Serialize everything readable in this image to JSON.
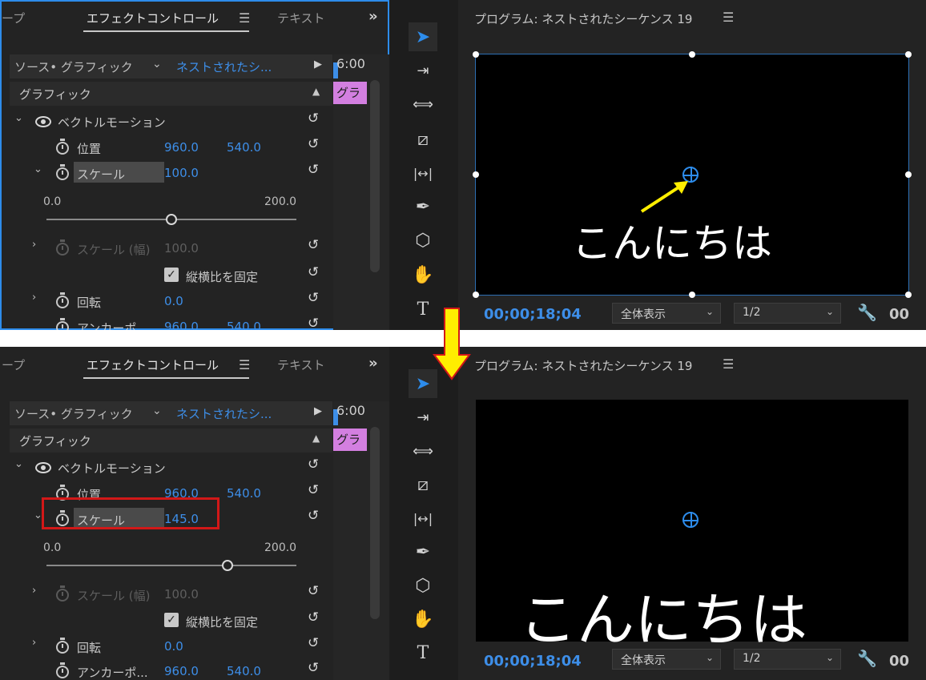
{
  "panels": [
    {
      "tabs": {
        "left_partial": "ープ",
        "active": "エフェクトコントロール",
        "text": "テキスト"
      },
      "source": {
        "label": "ソース• グラフィック",
        "clip": "ネストされたシ..."
      },
      "timeline_time": "6:00",
      "clip_label": "グラ",
      "section_title": "グラフィック",
      "effect_name": "ベクトルモーション",
      "position": {
        "label": "位置",
        "x": "960.0",
        "y": "540.0"
      },
      "scale": {
        "label": "スケール",
        "value": "100.0",
        "slider_min": "0.0",
        "slider_max": "200.0",
        "slider_fraction": 0.5
      },
      "scale_width": {
        "label": "スケール (幅)",
        "value": "100.0"
      },
      "lock_aspect": {
        "label": "縦横比を固定",
        "checked": true
      },
      "rotation": {
        "label": "回転",
        "value": "0.0"
      },
      "anchor": {
        "label": "アンカーポ",
        "x": "960.0",
        "y": "540.0"
      },
      "program": {
        "title": "プログラム: ネストされたシーケンス 19",
        "timecode": "00;00;18;04",
        "zoom": "全体表示",
        "resolution": "1/2",
        "timecode_right": "00",
        "text": "こんにちは"
      }
    },
    {
      "tabs": {
        "left_partial": "ープ",
        "active": "エフェクトコントロール",
        "text": "テキスト"
      },
      "source": {
        "label": "ソース• グラフィック",
        "clip": "ネストされたシ..."
      },
      "timeline_time": "6:00",
      "clip_label": "グラ",
      "section_title": "グラフィック",
      "effect_name": "ベクトルモーション",
      "position": {
        "label": "位置",
        "x": "960.0",
        "y": "540.0"
      },
      "scale": {
        "label": "スケール",
        "value": "145.0",
        "slider_min": "0.0",
        "slider_max": "200.0",
        "slider_fraction": 0.725
      },
      "scale_width": {
        "label": "スケール (幅)",
        "value": "100.0"
      },
      "lock_aspect": {
        "label": "縦横比を固定",
        "checked": true
      },
      "rotation": {
        "label": "回転",
        "value": "0.0"
      },
      "anchor": {
        "label": "アンカーポ...",
        "x": "960.0",
        "y": "540.0"
      },
      "program": {
        "title": "プログラム: ネストされたシーケンス 19",
        "timecode": "00;00;18;04",
        "zoom": "全体表示",
        "resolution": "1/2",
        "timecode_right": "00",
        "text": "こんにちは"
      }
    }
  ],
  "icons": {
    "menu": "☰",
    "overflow": "»",
    "chevron_down": "⌄",
    "play": "▶",
    "collapse": "▲",
    "twirl_open": "⌄",
    "twirl_closed": "›",
    "reset": "↺",
    "check": "✓",
    "wrench": "🔧"
  },
  "tools": [
    "selection-tool",
    "track-select-tool",
    "ripple-edit-tool",
    "razor-tool",
    "slip-tool",
    "pen-tool",
    "shape-tool",
    "hand-tool",
    "type-tool"
  ],
  "tool_glyphs": [
    "➤",
    "⇥",
    "⟺",
    "⧄",
    "|↔|",
    "✒",
    "⬡",
    "✋",
    "T"
  ],
  "colors": {
    "accent_blue": "#3d8ee8",
    "highlight_red": "#d21818",
    "arrow_yellow": "#ffee00"
  }
}
